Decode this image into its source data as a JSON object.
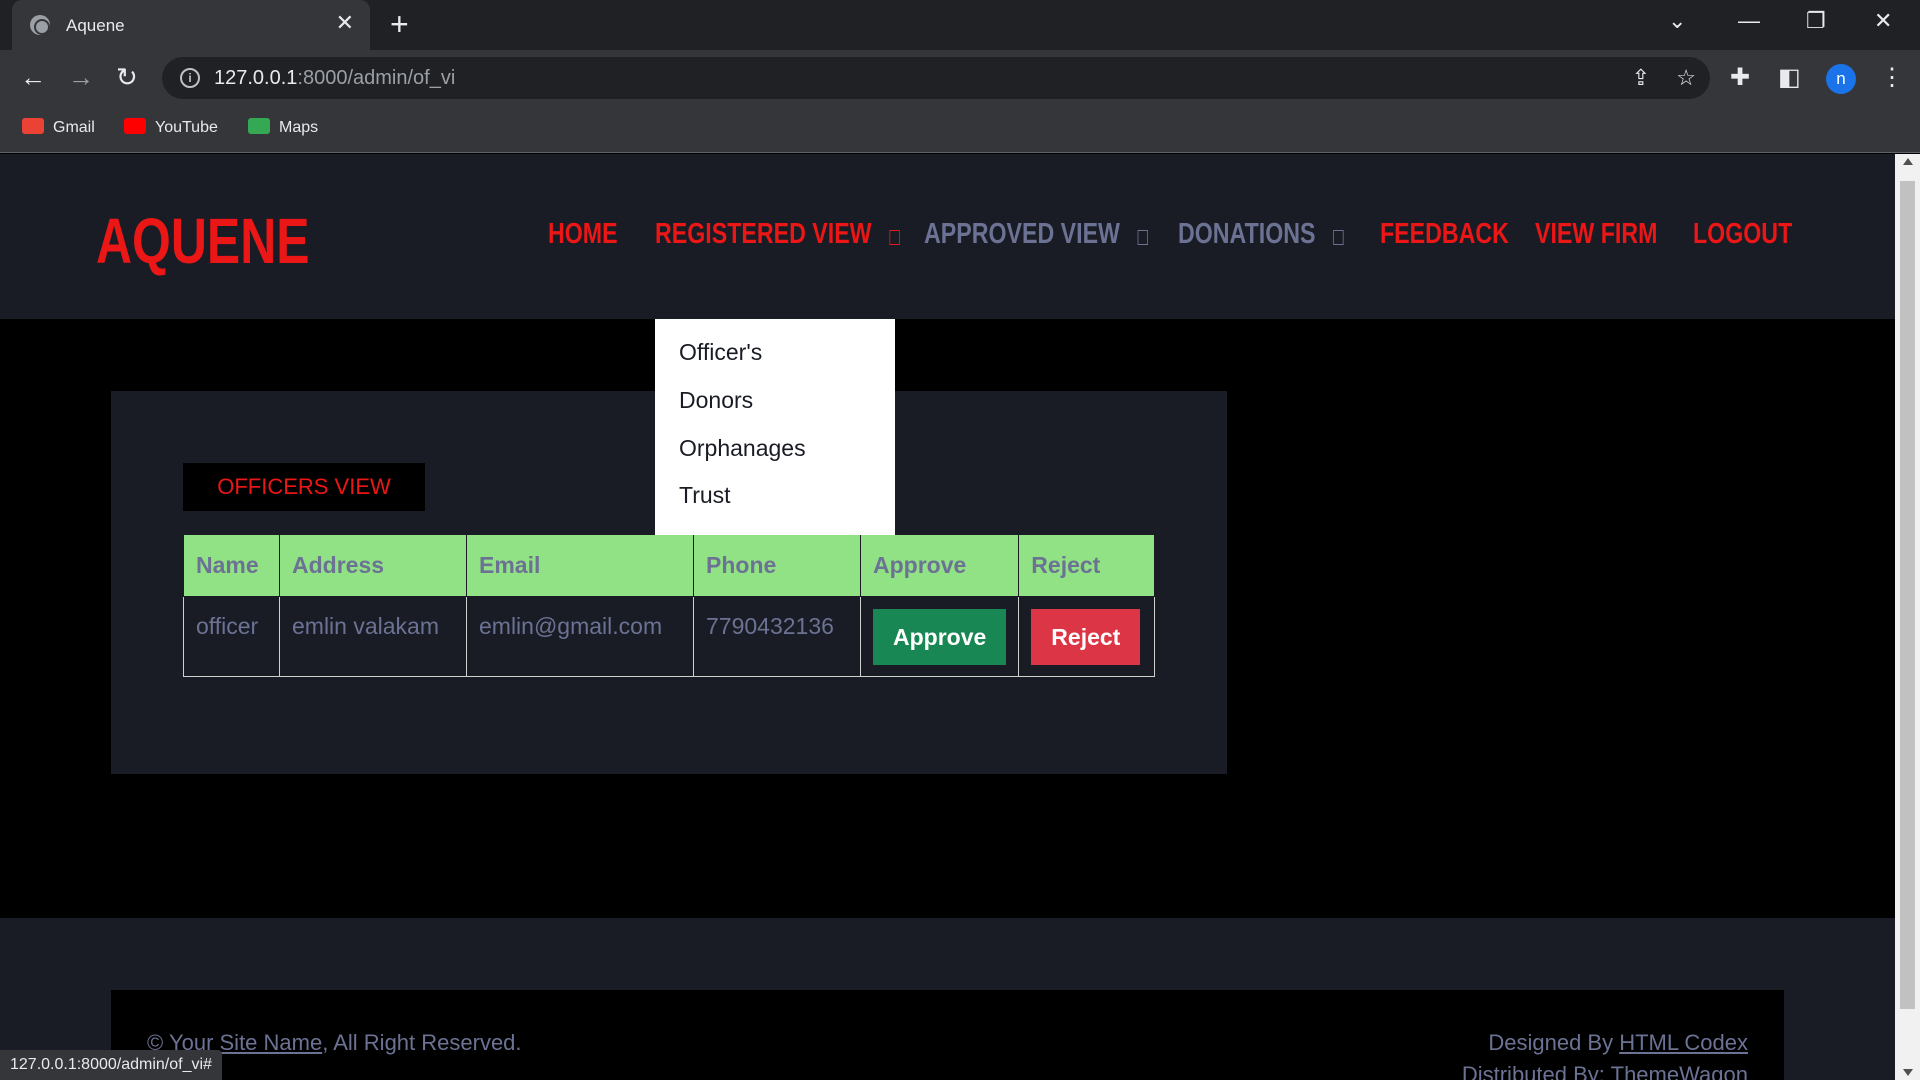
{
  "browser": {
    "tab_title": "Aquene",
    "url_host": "127.0.0.1",
    "url_path": ":8000/admin/of_vi",
    "profile_initial": "n",
    "bookmarks": [
      {
        "label": "Gmail",
        "icon": "gmail-icon",
        "color": "#ea4335"
      },
      {
        "label": "YouTube",
        "icon": "youtube-icon",
        "color": "#ff0000"
      },
      {
        "label": "Maps",
        "icon": "maps-icon",
        "color": "#34a853"
      }
    ],
    "status_url": "127.0.0.1:8000/admin/of_vi#"
  },
  "site": {
    "brand": "AQUENE",
    "brand_color": "#eb1616",
    "nav": {
      "home": "HOME",
      "registered_view": "REGISTERED VIEW",
      "approved_view": "APPROVED VIEW",
      "donations": "DONATIONS",
      "feedback": "FEEDBACK",
      "view_firm": "VIEW FIRM",
      "logout": "LOGOUT"
    },
    "dropdown": [
      "Officer's",
      "Donors",
      "Orphanages",
      "Trust"
    ]
  },
  "content": {
    "section_title": "OFFICERS VIEW",
    "table": {
      "headers": [
        "Name",
        "Address",
        "Email",
        "Phone",
        "Approve",
        "Reject"
      ],
      "rows": [
        {
          "name": "officer",
          "address": "emlin valakam",
          "email": "emlin@gmail.com",
          "phone": "7790432136",
          "approve": "Approve",
          "reject": "Reject"
        }
      ]
    }
  },
  "footer": {
    "copyright_prefix": "© ",
    "site_name": "Your Site Name",
    "copyright_suffix": ", All Right Reserved.",
    "designed_by_prefix": "Designed By ",
    "designed_by_link": "HTML Codex",
    "distributed_by_prefix": "Distributed By: ",
    "distributed_by_link": "ThemeWagon"
  }
}
